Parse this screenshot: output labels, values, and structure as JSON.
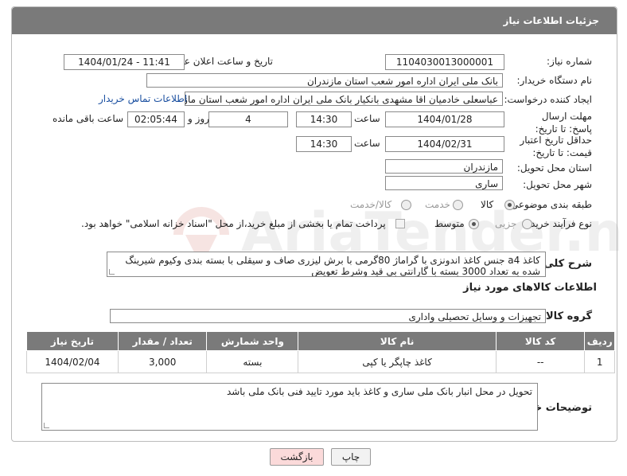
{
  "header": {
    "title": "جزئیات اطلاعات نیاز"
  },
  "fields": {
    "need_number_label": "شماره نیاز:",
    "need_number": "1104030013000001",
    "announce_label": "تاریخ و ساعت اعلان عمومی:",
    "announce_value": "1404/01/24 - 11:41",
    "buyer_org_label": "نام دستگاه خریدار:",
    "buyer_org": "بانک ملی ایران اداره امور شعب استان مازندران",
    "creator_label": "ایجاد کننده درخواست:",
    "creator": "عباسعلی خادمیان اقا مشهدی بانکیار بانک ملی ایران اداره امور شعب استان ماز",
    "contact_link": "اطلاعات تماس خریدار",
    "deadline_label": "مهلت ارسال پاسخ: تا تاریخ:",
    "deadline_date": "1404/01/28",
    "time_label": "ساعت",
    "deadline_time": "14:30",
    "days_value": "4",
    "days_label": "روز و",
    "remaining_value": "02:05:44",
    "remaining_label": "ساعت باقی مانده",
    "validity_label": "حداقل تاریخ اعتبار قیمت: تا تاریخ:",
    "validity_date": "1404/02/31",
    "validity_time": "14:30",
    "province_label": "استان محل تحویل:",
    "province": "مازندران",
    "city_label": "شهر محل تحویل:",
    "city": "ساری",
    "category_label": "طبقه بندی موضوعی:",
    "category_options": [
      "کالا",
      "خدمت",
      "کالا/خدمت"
    ],
    "process_label": "نوع فرآیند خرید :",
    "process_options": [
      "جزیی",
      "متوسط"
    ],
    "payment_note": "پرداخت تمام یا بخشی از مبلغ خرید،از محل \"اسناد خزانه اسلامی\" خواهد بود.",
    "description_label": "شرح کلی نیاز:",
    "description": "کاغذ a4 جنس کاغذ اندونزی با گراماژ 80گرمی با برش لیزری صاف و سیقلی با بسته بندی وکیوم شیرینگ شده به تعداد 3000 بسته با گارانتی بی قید وشرط تعویض",
    "goods_info_title": "اطلاعات کالاهای مورد نیاز",
    "goods_group_label": "گروه کالا:",
    "goods_group": "تجهیزات و وسایل تحصیلی واداری",
    "buyer_notes_label": "توضیحات خریدار:",
    "buyer_notes": "تحویل در محل انبار  بانک ملی ساری و کاغذ باید مورد تایید فنی بانک ملی باشد"
  },
  "table": {
    "headers": [
      "ردیف",
      "کد کالا",
      "نام کالا",
      "واحد شمارش",
      "تعداد / مقدار",
      "تاریخ نیاز"
    ],
    "rows": [
      [
        "1",
        "--",
        "کاغذ چاپگر یا کپی",
        "بسته",
        "3,000",
        "1404/02/04"
      ]
    ]
  },
  "buttons": {
    "print": "چاپ",
    "back": "بازگشت"
  },
  "watermark_text": "AriaTender.neT",
  "colors": {
    "header_bg": "#7a7a7a",
    "link": "#1a4fa0",
    "back_btn_bg": "#fbdada",
    "print_btn_bg": "#f2f2f2"
  }
}
